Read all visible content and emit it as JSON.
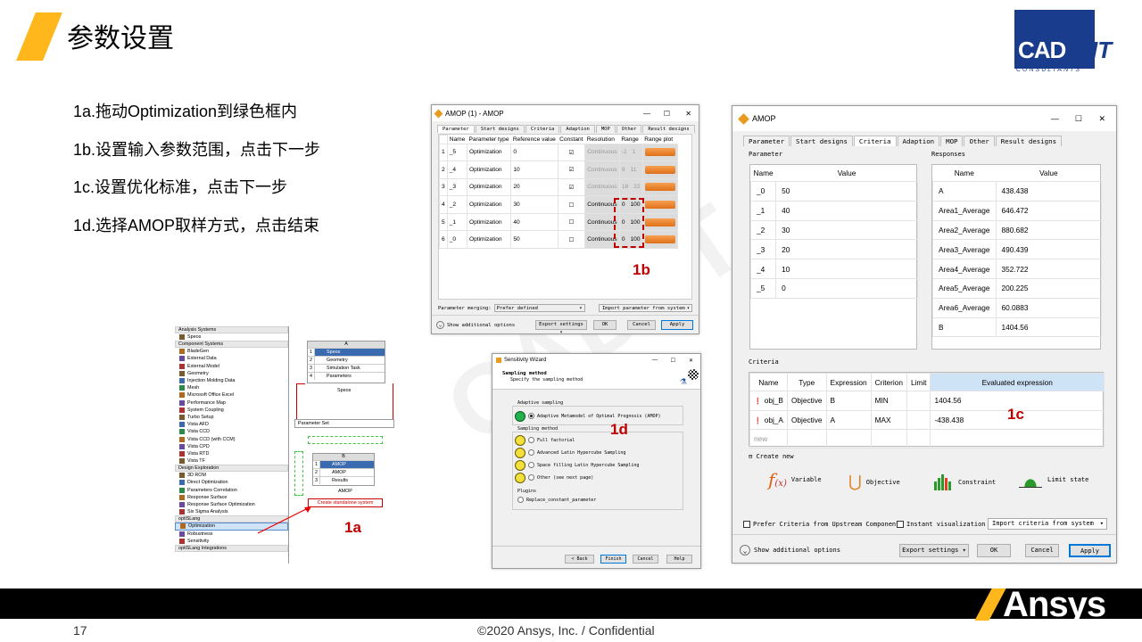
{
  "slide": {
    "title": "参数设置",
    "page_number": "17",
    "footer": "©2020 Ansys, Inc. / Confidential",
    "accent_color": "#ffb71b",
    "cadfem_logo": {
      "text": "CAD",
      "suffix": "IT",
      "subtitle": "CONSULTANTS"
    },
    "ansys_logo": "Ansys",
    "watermark": "CAD-IT"
  },
  "steps": [
    "1a.拖动Optimization到绿色框内",
    "1b.设置输入参数范围，点击下一步",
    "1c.设置优化标准，点击下一步",
    "1d.选择AMOP取样方式，点击结束"
  ],
  "annotations": {
    "a": "1a",
    "b": "1b",
    "c": "1c",
    "d": "1d"
  },
  "workbench": {
    "groups": [
      {
        "header": "Analysis Systems",
        "items": [
          "Speos"
        ]
      },
      {
        "header": "Component Systems",
        "items": [
          "BladeGen",
          "External Data",
          "External Model",
          "Geometry",
          "Injection Molding Data",
          "Mesh",
          "Microsoft Office Excel",
          "Performance Map",
          "System Coupling",
          "Turbo Setup",
          "Vista AFD",
          "Vista CCD",
          "Vista CCD (with CCM)",
          "Vista CPD",
          "Vista RTD",
          "Vista TF"
        ]
      },
      {
        "header": "Design Exploration",
        "items": [
          "3D ROM",
          "Direct Optimization",
          "Parameters Correlation",
          "Response Surface",
          "Response Surface Optimization",
          "Six Sigma Analysis"
        ]
      },
      {
        "header": "optiSLang",
        "items": [
          "Optimization",
          "Robustness",
          "Sensitivity"
        ]
      },
      {
        "header": "optiSLang Integrations",
        "items": []
      }
    ],
    "system_a": {
      "letter": "A",
      "rows": [
        "Speos",
        "Geometry",
        "Simulation Task",
        "Parameters"
      ],
      "caption": "Speos"
    },
    "parameter_set": "Parameter Set",
    "system_b": {
      "letter": "B",
      "rows": [
        "AMOP",
        "AMOP",
        "Results"
      ],
      "caption": "AMOP"
    },
    "create_standalone": "Create standalone system"
  },
  "amop1": {
    "title": "AMOP (1) - AMOP",
    "tabs": [
      "Parameter",
      "Start designs",
      "Criteria",
      "Adaption",
      "MOP",
      "Other",
      "Result designs"
    ],
    "columns": [
      "Name",
      "Parameter type",
      "Reference value",
      "Constant",
      "Resolution",
      "Range",
      "Range plot"
    ],
    "rows": [
      {
        "idx": "1",
        "name": "_5",
        "type": "Optimization",
        "ref": "0",
        "constant": true,
        "res": "Continuous",
        "lo": "-1",
        "hi": "1"
      },
      {
        "idx": "2",
        "name": "_4",
        "type": "Optimization",
        "ref": "10",
        "constant": true,
        "res": "Continuous",
        "lo": "9",
        "hi": "11"
      },
      {
        "idx": "3",
        "name": "_3",
        "type": "Optimization",
        "ref": "20",
        "constant": true,
        "res": "Continuous",
        "lo": "18",
        "hi": "22"
      },
      {
        "idx": "4",
        "name": "_2",
        "type": "Optimization",
        "ref": "30",
        "constant": false,
        "res": "Continuous",
        "lo": "0",
        "hi": "100"
      },
      {
        "idx": "5",
        "name": "_1",
        "type": "Optimization",
        "ref": "40",
        "constant": false,
        "res": "Continuous",
        "lo": "0",
        "hi": "100"
      },
      {
        "idx": "6",
        "name": "_0",
        "type": "Optimization",
        "ref": "50",
        "constant": false,
        "res": "Continuous",
        "lo": "0",
        "hi": "100"
      }
    ],
    "merging_label": "Parameter merging:",
    "merging_value": "Prefer defined",
    "import_label": "Import parameter from system",
    "show_options": "Show additional options",
    "export_label": "Export settings",
    "ok": "OK",
    "cancel": "Cancel",
    "apply": "Apply"
  },
  "wizard": {
    "title": "Sensitivity Wizard",
    "heading": "Sampling method",
    "sub": "Specify the sampling method",
    "adaptive_group": "Adaptive sampling",
    "adaptive_option": "Adaptive Metamodel of Optimal Prognosis (AMOP)",
    "sampling_group": "Sampling method",
    "options": [
      "Full factorial",
      "Advanced Latin Hypercube Sampling",
      "Space filling Latin Hypercube Sampling",
      "Other (see next page)"
    ],
    "plugins_group": "Plugins",
    "plugin": "Replace_constant_parameter",
    "back": "< Back",
    "finish": "Finish",
    "cancel": "Cancel",
    "help": "Help"
  },
  "amop2": {
    "title": "AMOP",
    "tabs": [
      "Parameter",
      "Start designs",
      "Criteria",
      "Adaption",
      "MOP",
      "Other",
      "Result designs"
    ],
    "param_group": "Parameter",
    "param_cols": [
      "Name",
      "Value"
    ],
    "params": [
      [
        "_0",
        "50"
      ],
      [
        "_1",
        "40"
      ],
      [
        "_2",
        "30"
      ],
      [
        "_3",
        "20"
      ],
      [
        "_4",
        "10"
      ],
      [
        "_5",
        "0"
      ]
    ],
    "resp_group": "Responses",
    "resp_cols": [
      "Name",
      "Value"
    ],
    "responses": [
      [
        "A",
        "438.438"
      ],
      [
        "Area1_Average",
        "646.472"
      ],
      [
        "Area2_Average",
        "880.682"
      ],
      [
        "Area3_Average",
        "490.439"
      ],
      [
        "Area4_Average",
        "352.722"
      ],
      [
        "Area5_Average",
        "200.225"
      ],
      [
        "Area6_Average",
        "60.0883"
      ],
      [
        "B",
        "1404.56"
      ]
    ],
    "criteria_group": "Criteria",
    "criteria_cols": [
      "Name",
      "Type",
      "Expression",
      "Criterion",
      "Limit",
      "Evaluated expression"
    ],
    "criteria": [
      [
        "obj_B",
        "Objective",
        "B",
        "MIN",
        "",
        "1404.56"
      ],
      [
        "obj_A",
        "Objective",
        "A",
        "MAX",
        "",
        "-438.438"
      ]
    ],
    "new_row": "new",
    "create_new": "Create new",
    "create_items": [
      "Variable",
      "Objective",
      "Constraint",
      "Limit state"
    ],
    "prefer_label": "Prefer Criteria from Upstream Component",
    "instant_label": "Instant visualization",
    "import_label": "Import criteria from system",
    "show_options": "Show additional options",
    "export_label": "Export settings",
    "ok": "OK",
    "cancel": "Cancel",
    "apply": "Apply"
  }
}
